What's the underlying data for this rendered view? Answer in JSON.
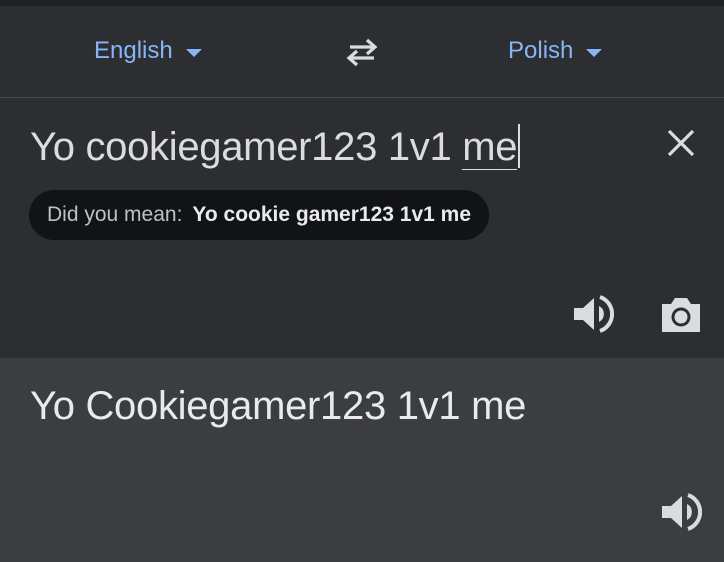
{
  "languages": {
    "source": "English",
    "target": "Polish",
    "swap_icon": "swap-arrows-icon",
    "caret_icon": "caret-down-icon"
  },
  "input": {
    "text_main": "Yo cookiegamer123 1v1 ",
    "text_last_word": "me",
    "clear_icon": "close-icon"
  },
  "suggestion": {
    "prefix": "Did you mean:",
    "corrected": "Yo cookie gamer123 1v1 me"
  },
  "input_actions": {
    "listen_icon": "speaker-icon",
    "camera_icon": "camera-icon"
  },
  "output": {
    "text": "Yo Cookiegamer123 1v1 me",
    "listen_icon": "speaker-icon"
  },
  "colors": {
    "accent": "#8ab4f8",
    "background": "#2d2e31",
    "output_background": "#3c3d41",
    "suggestion_background": "#121315",
    "icon": "#dadce0"
  }
}
